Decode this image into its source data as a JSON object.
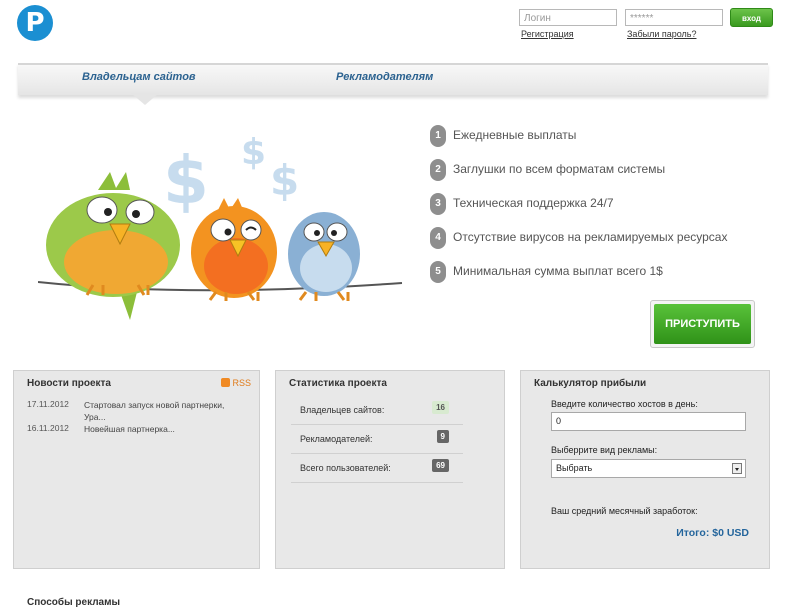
{
  "header": {
    "logo_letter": "P",
    "login_placeholder": "Логин",
    "password_placeholder": "******",
    "enter_label": "вход",
    "register_link": "Регистрация",
    "forgot_link": "Забыли пароль?"
  },
  "nav": {
    "tabs": [
      {
        "label": "Владельцам сайтов",
        "active": true
      },
      {
        "label": "Рекламодателям",
        "active": false
      }
    ]
  },
  "hero": {
    "features": [
      {
        "num": "1",
        "text": "Ежедневные выплаты"
      },
      {
        "num": "2",
        "text": "Заглушки по всем форматам системы"
      },
      {
        "num": "3",
        "text": "Техническая поддержка 24/7"
      },
      {
        "num": "4",
        "text": "Отсутствие вирусов на рекламируемых ресурсах"
      },
      {
        "num": "5",
        "text": "Минимальная сумма выплат всего 1$"
      }
    ],
    "start_label": "ПРИСТУПИТЬ"
  },
  "news": {
    "title": "Новости проекта",
    "rss_label": "RSS",
    "items": [
      {
        "date": "17.11.2012",
        "text": "Стартовал запуск новой партнерки, Ура..."
      },
      {
        "date": "16.11.2012",
        "text": "Новейшая партнерка..."
      }
    ]
  },
  "stats": {
    "title": "Статистика проекта",
    "rows": [
      {
        "label": "Владельцев сайтов:",
        "value": "16"
      },
      {
        "label": "Рекламодателей:",
        "value": "9"
      },
      {
        "label": "Всего пользователей:",
        "value": "69"
      }
    ]
  },
  "calc": {
    "title": "Калькулятор прибыли",
    "hosts_label": "Введите количество хостов в день:",
    "hosts_value": "0",
    "ad_type_label": "Выберрите вид рекламы:",
    "ad_type_value": "Выбрать",
    "earnings_label": "Ваш средний месячный заработок:",
    "total_label": "Итого: $0 USD"
  },
  "footer": {
    "partial_heading": "Способы рекламы"
  },
  "colors": {
    "brand_blue": "#1b8fd2",
    "nav_link": "#2b6290",
    "green_button": "#3a9a1f",
    "total_blue": "#24659c"
  }
}
